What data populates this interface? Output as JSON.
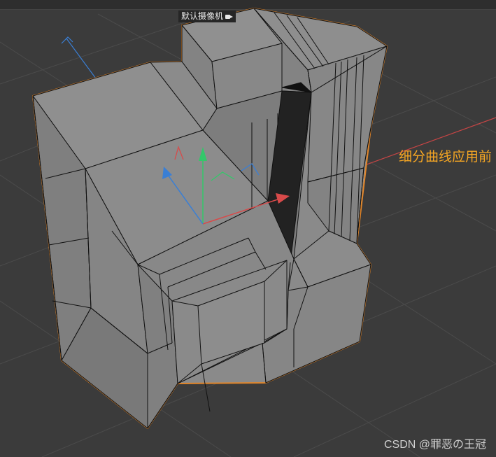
{
  "viewport": {
    "camera_label": "默认摄像机",
    "camera_icon": "camera-icon"
  },
  "annotation": {
    "text": "细分曲线应用前",
    "color": "#f5a623"
  },
  "watermark": {
    "text": "CSDN @罪恶の王冠"
  },
  "colors": {
    "background": "#3b3b3b",
    "grid": "#4a4a4a",
    "mesh_face": "#8b8b8b",
    "mesh_edge": "#111111",
    "selection_outline": "#e0852a",
    "axis_x": "#d84a4a",
    "axis_y": "#33c86a",
    "axis_z": "#3a7fd5",
    "selected_polygon": "#222222"
  }
}
